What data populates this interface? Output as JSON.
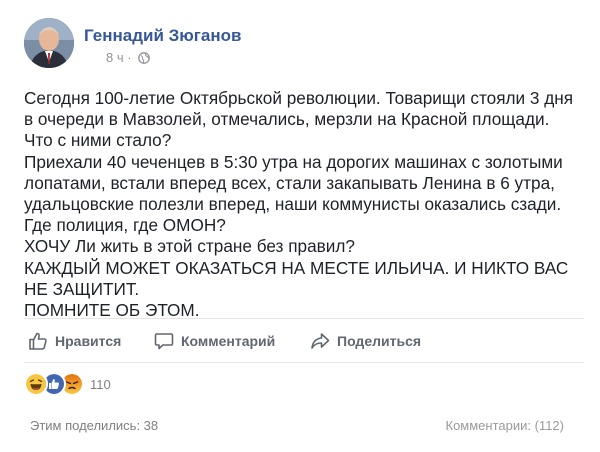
{
  "post": {
    "author": "Геннадий Зюганов",
    "time": "8 ч ·",
    "lines": [
      "Сегодня 100-летие Октябрьской революции. Товарищи стояли 3 дня",
      "в очереди в Мавзолей, отмечались, мерзли на Красной площади.",
      "Что с ними стало?",
      "Приехали 40 чеченцев в 5:30 утра на дорогих машинах с золотыми",
      "лопатами, встали вперед всех, стали закапывать Ленина в 6 утра,",
      "удальцовские полезли вперед, наши коммунисты оказались сзади.",
      "Где полиция, где ОМОН?",
      "ХОЧУ Ли жить в этой стране без правил?",
      "КАЖДЫЙ МОЖЕТ ОКАЗАТЬСЯ НА МЕСТЕ ИЛЬИЧА. И НИКТО ВАС",
      "НЕ ЗАЩИТИТ.",
      "ПОМНИТЕ ОБ ЭТОМ."
    ]
  },
  "actions": {
    "like": "Нравится",
    "comment": "Комментарий",
    "share": "Поделиться"
  },
  "reactions": {
    "icons": [
      "haha-icon",
      "like-icon",
      "angry-icon"
    ],
    "count": "110"
  },
  "footer": {
    "shared": "Этим поделились: 38",
    "comments": "Комментарии: (112)"
  },
  "colors": {
    "author": "#365899",
    "like": "#4267b2",
    "haha": "#f7c744",
    "angry": "#e9710f"
  }
}
